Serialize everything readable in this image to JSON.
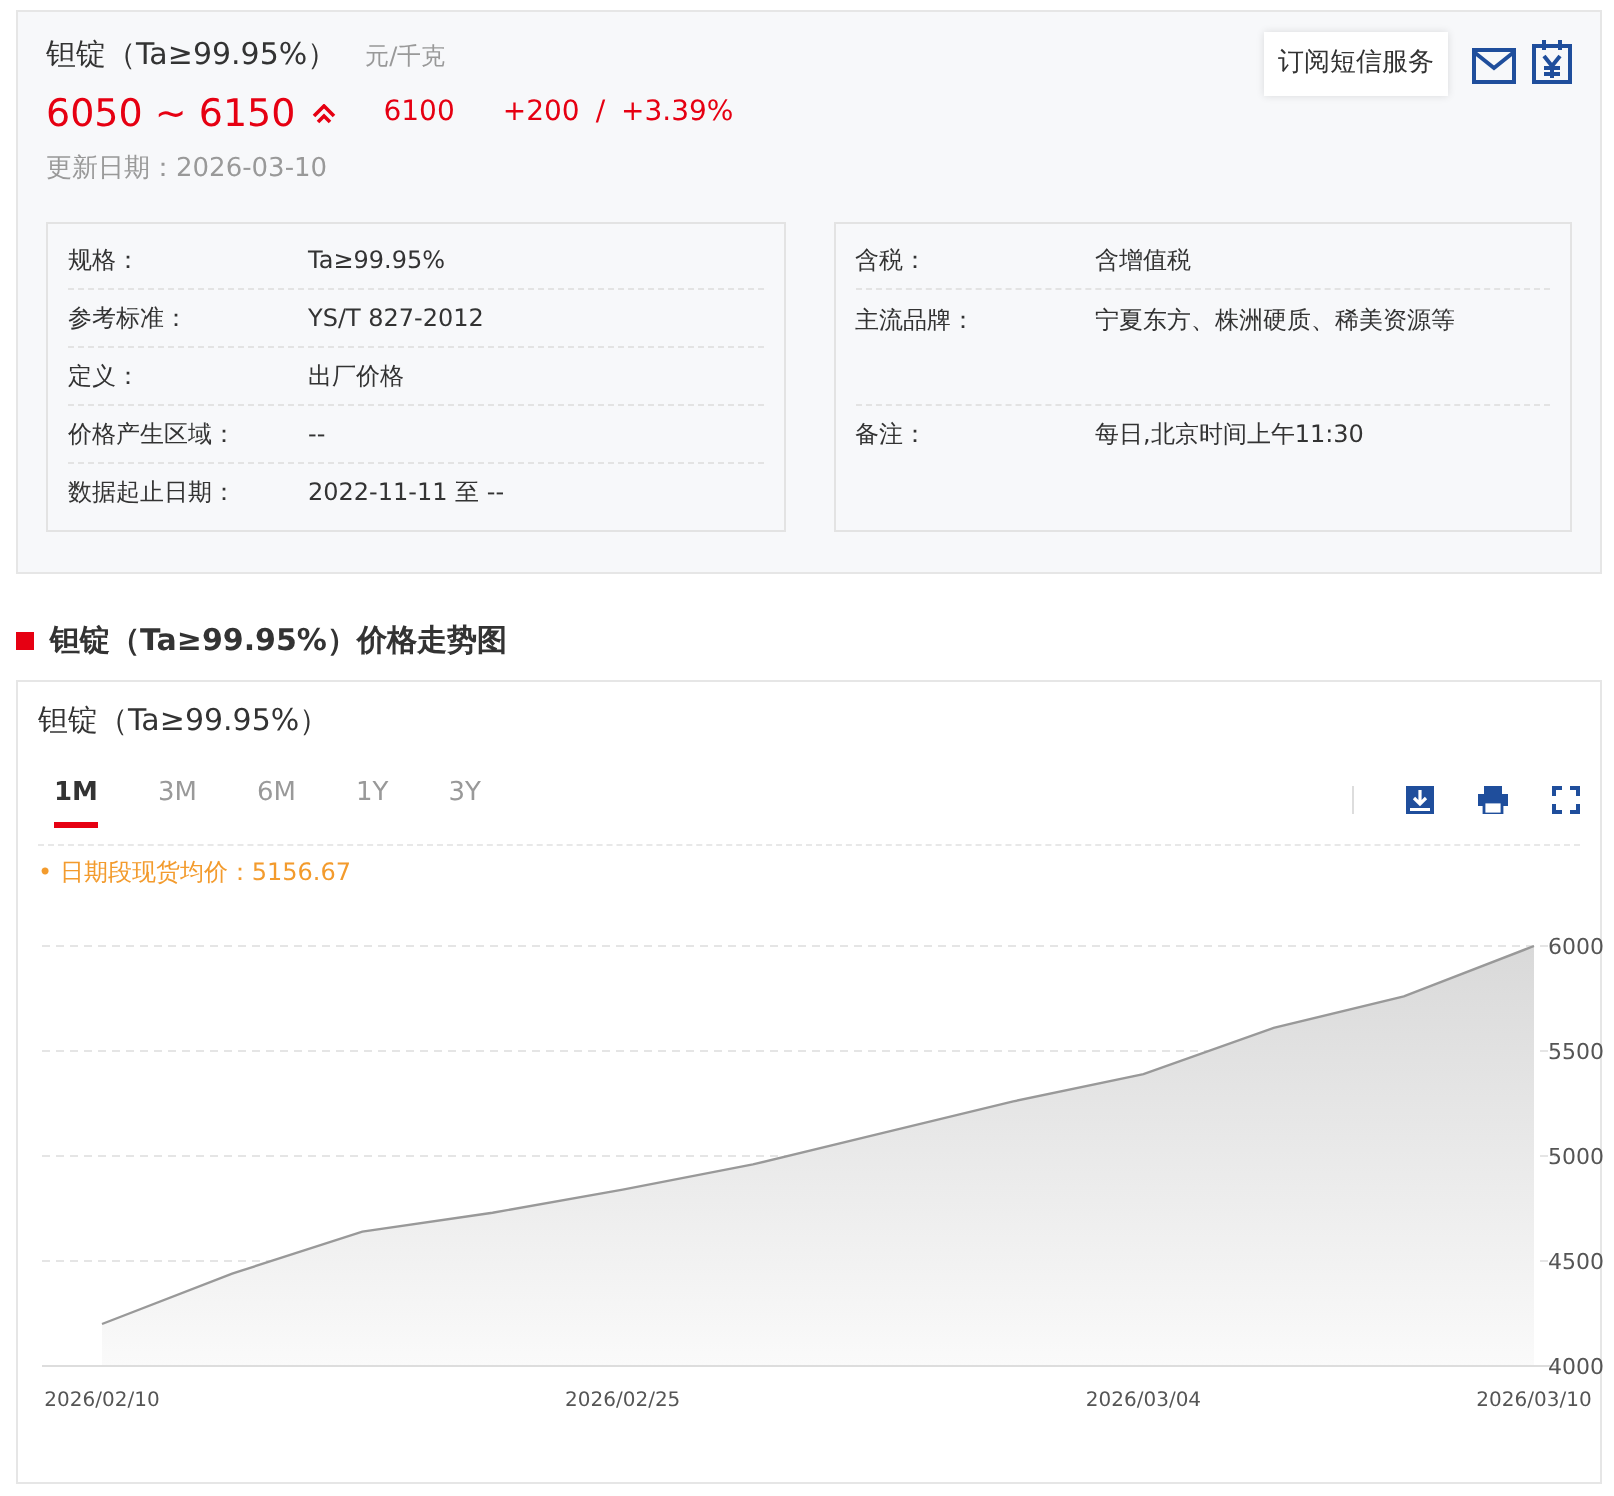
{
  "header": {
    "title": "钽锭（Ta≥99.95%）",
    "unit": "元/千克",
    "price_range": "6050 ~ 6150",
    "rising": true,
    "average": "6100",
    "change": "+200",
    "separator": "/",
    "change_percent": "+3.39%",
    "updated": "更新日期：2026-03-10",
    "subscribe_button": "订阅短信服务"
  },
  "details_left": [
    {
      "label": "规格：",
      "value": "Ta≥99.95%"
    },
    {
      "label": "参考标准：",
      "value": "YS/T 827-2012"
    },
    {
      "label": "定义：",
      "value": "出厂价格"
    },
    {
      "label": "价格产生区域：",
      "value": "--"
    },
    {
      "label": "数据起止日期：",
      "value": "2022-11-11 至 --"
    }
  ],
  "details_right": [
    {
      "label": "含税：",
      "value": "含增值税",
      "tall": false
    },
    {
      "label": "主流品牌：",
      "value": "宁夏东方、株洲硬质、稀美资源等",
      "tall": true
    },
    {
      "label": "备注：",
      "value": "每日,北京时间上午11:30",
      "tall": false
    }
  ],
  "section_title": "钽锭（Ta≥99.95%）价格走势图",
  "chart_panel": {
    "title": "钽锭（Ta≥99.95%）",
    "tabs": [
      {
        "label": "1M",
        "selected": true
      },
      {
        "label": "3M",
        "selected": false
      },
      {
        "label": "6M",
        "selected": false
      },
      {
        "label": "1Y",
        "selected": false
      },
      {
        "label": "3Y",
        "selected": false
      }
    ],
    "average_note": "• 日期段现货均价：5156.67",
    "chart_data": {
      "type": "area",
      "categories": [
        "2026/02/10",
        null,
        null,
        null,
        "2026/02/25",
        null,
        null,
        null,
        "2026/03/04",
        null,
        null,
        "2026/03/10"
      ],
      "grid": true,
      "series": [
        {
          "color": "#999999",
          "values": [
            4200,
            4440,
            4640,
            4730,
            4840,
            4960,
            5110,
            5260,
            5390,
            5610,
            5760,
            6000
          ]
        }
      ],
      "ylim": [
        4000,
        6000
      ],
      "yticks": [
        4000,
        4500,
        5000,
        5500,
        6000
      ]
    }
  }
}
